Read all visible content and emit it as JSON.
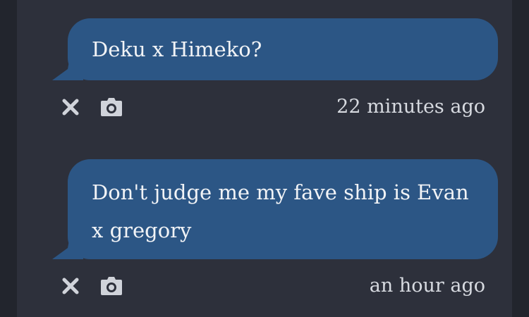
{
  "messages": [
    {
      "text": "Deku x Himeko?",
      "time": "22 minutes ago"
    },
    {
      "text": "Don't judge me my fave ship is Evan x gregory",
      "time": "an hour ago"
    }
  ],
  "icons": {
    "delete": "close-icon",
    "photo": "camera-icon"
  },
  "colors": {
    "bubble": "#2c5685",
    "background": "#2d303b",
    "text": "#f1f3f6",
    "icon": "#d0d3da"
  }
}
